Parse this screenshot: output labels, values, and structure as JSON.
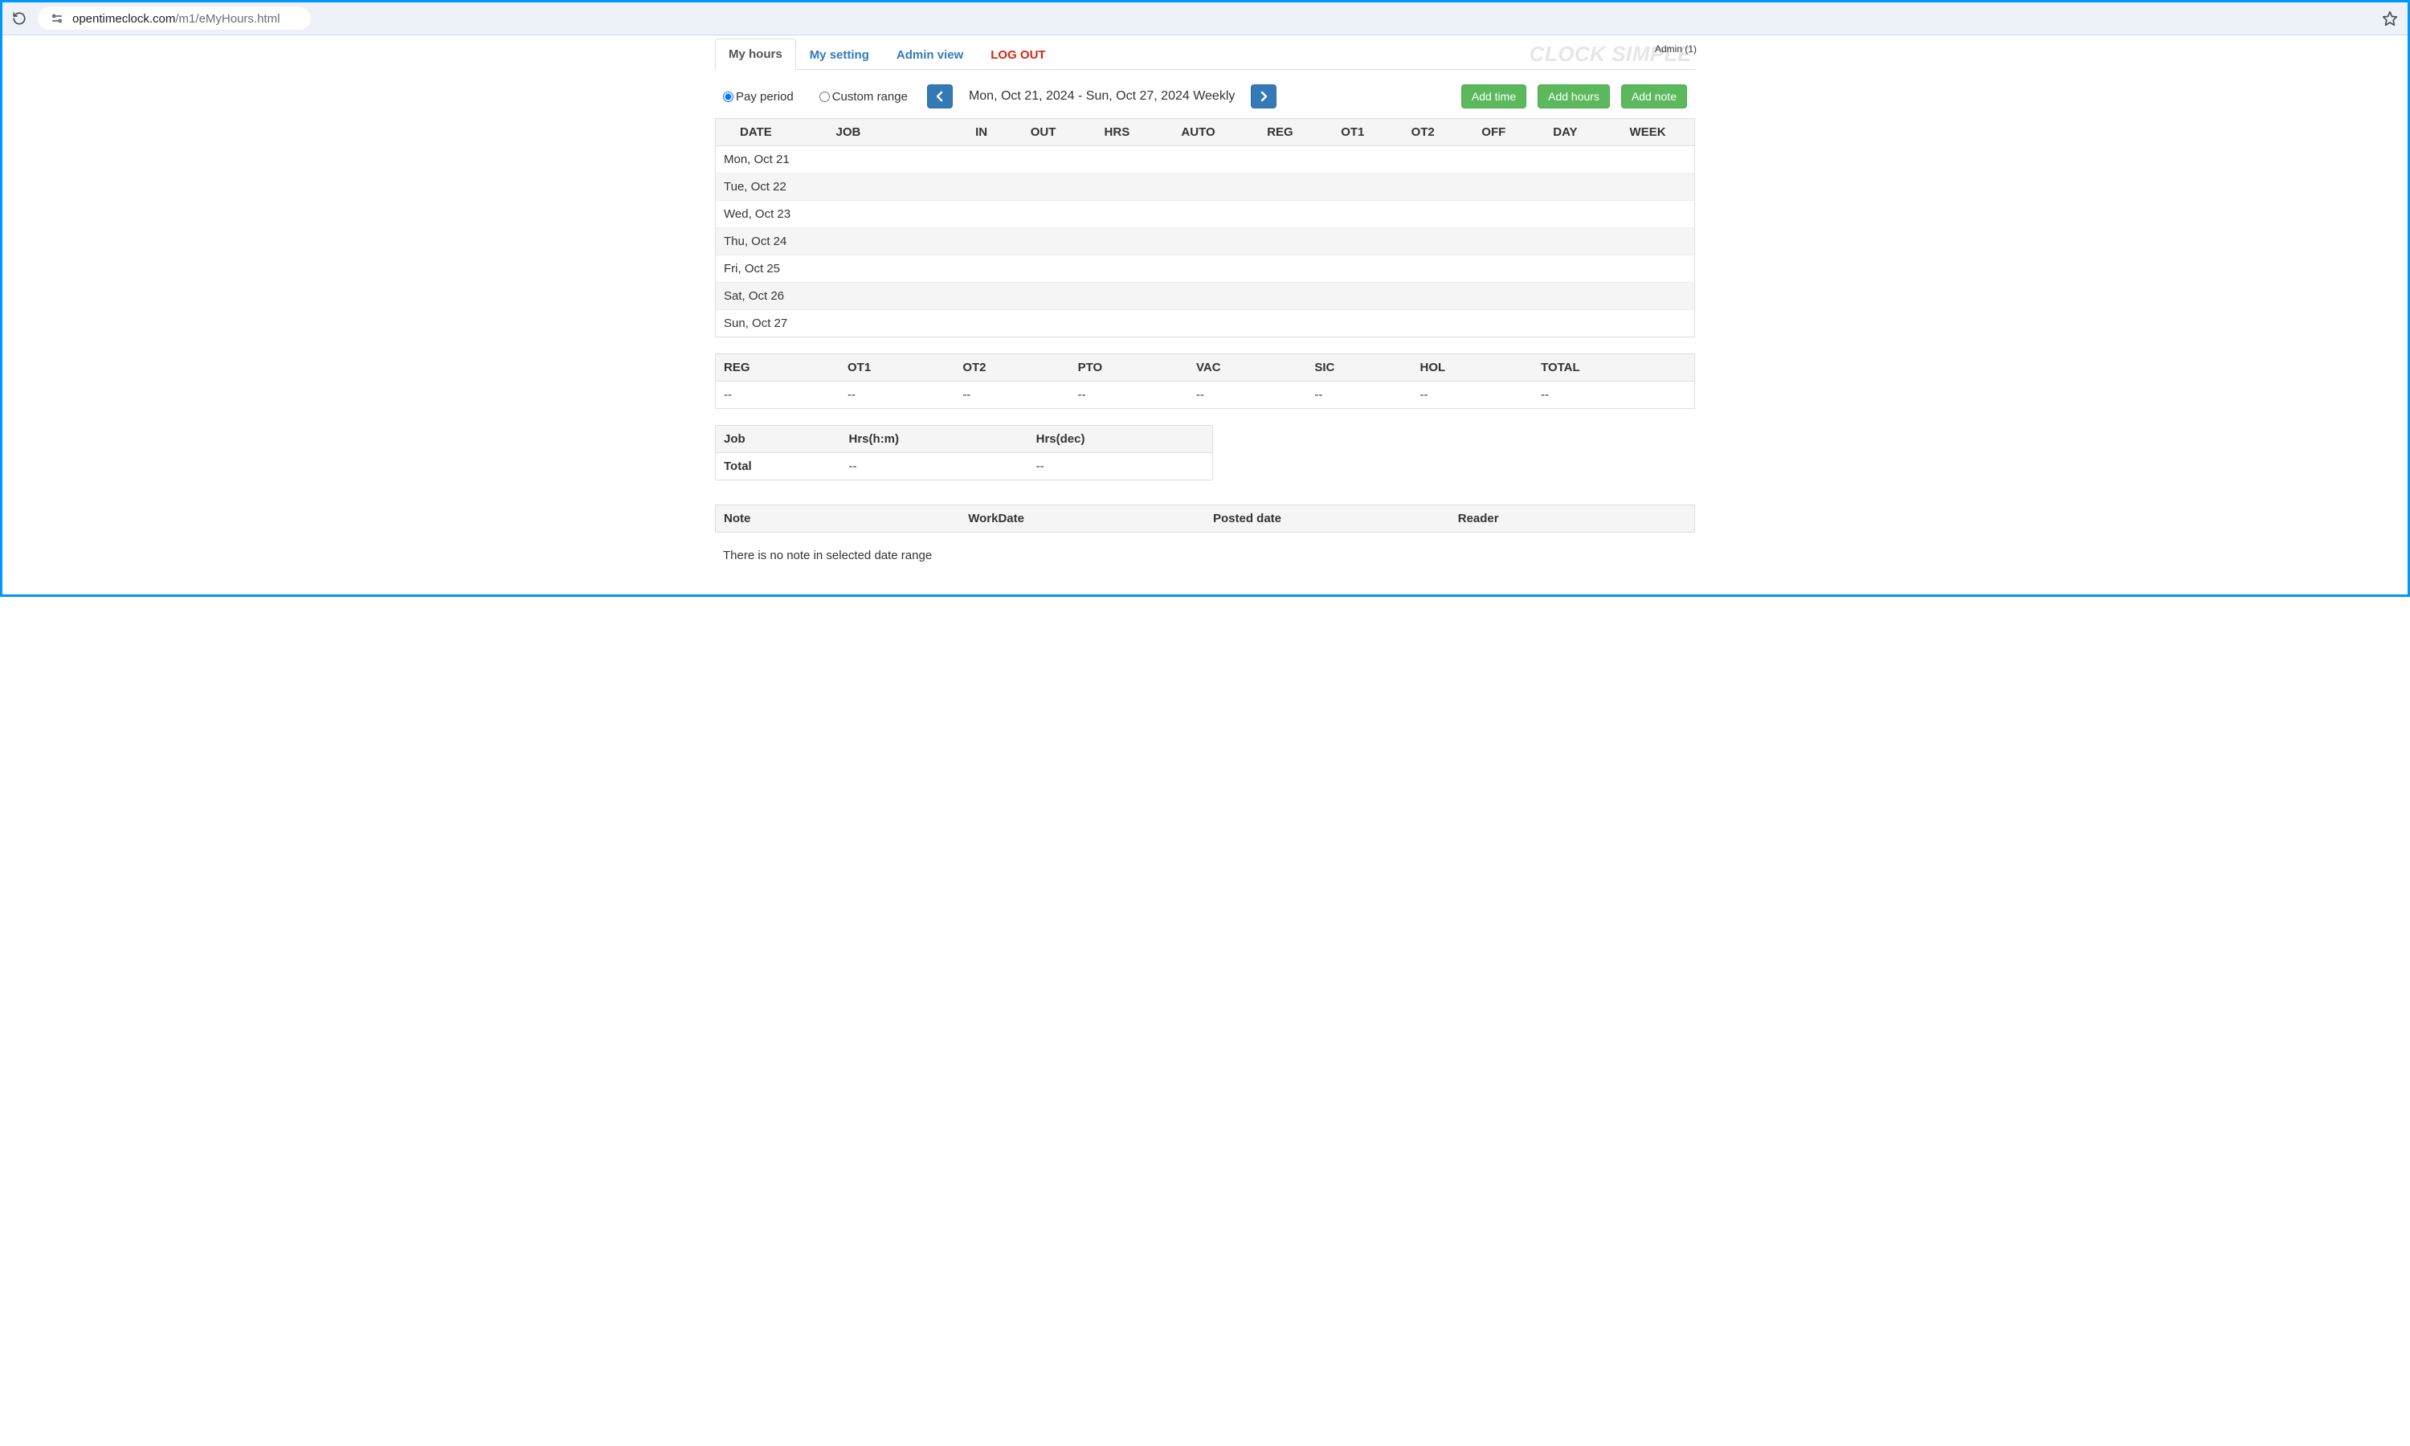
{
  "browser": {
    "url_host": "opentimeclock.com",
    "url_path": "/m1/eMyHours.html"
  },
  "header": {
    "admin_tag": "Admin (1)",
    "brand": "CLOCK SIMPLE",
    "tabs": {
      "my_hours": "My hours",
      "my_setting": "My setting",
      "admin_view": "Admin view",
      "log_out": "LOG OUT"
    }
  },
  "controls": {
    "pay_period_label": "Pay period",
    "custom_range_label": "Custom range",
    "date_range_text": "Mon, Oct 21, 2024 - Sun, Oct 27, 2024 Weekly",
    "add_time": "Add time",
    "add_hours": "Add hours",
    "add_note": "Add note"
  },
  "hours_table": {
    "headers": {
      "date": "DATE",
      "job": "JOB",
      "in": "IN",
      "out": "OUT",
      "hrs": "HRS",
      "auto": "AUTO",
      "reg": "REG",
      "ot1": "OT1",
      "ot2": "OT2",
      "off": "OFF",
      "day": "DAY",
      "week": "WEEK"
    },
    "rows": [
      {
        "date": "Mon, Oct 21"
      },
      {
        "date": "Tue, Oct 22"
      },
      {
        "date": "Wed, Oct 23"
      },
      {
        "date": "Thu, Oct 24"
      },
      {
        "date": "Fri, Oct 25"
      },
      {
        "date": "Sat, Oct 26"
      },
      {
        "date": "Sun, Oct 27"
      }
    ]
  },
  "summary_table": {
    "headers": {
      "reg": "REG",
      "ot1": "OT1",
      "ot2": "OT2",
      "pto": "PTO",
      "vac": "VAC",
      "sic": "SIC",
      "hol": "HOL",
      "total": "TOTAL"
    },
    "values": {
      "reg": "--",
      "ot1": "--",
      "ot2": "--",
      "pto": "--",
      "vac": "--",
      "sic": "--",
      "hol": "--",
      "total": "--"
    }
  },
  "job_table": {
    "headers": {
      "job": "Job",
      "hrs_hm": "Hrs(h:m)",
      "hrs_dec": "Hrs(dec)"
    },
    "row": {
      "job": "Total",
      "hrs_hm": "--",
      "hrs_dec": "--"
    }
  },
  "notes_table": {
    "headers": {
      "note": "Note",
      "workdate": "WorkDate",
      "posted": "Posted date",
      "reader": "Reader"
    },
    "empty_text": "There is no note in selected date range"
  }
}
